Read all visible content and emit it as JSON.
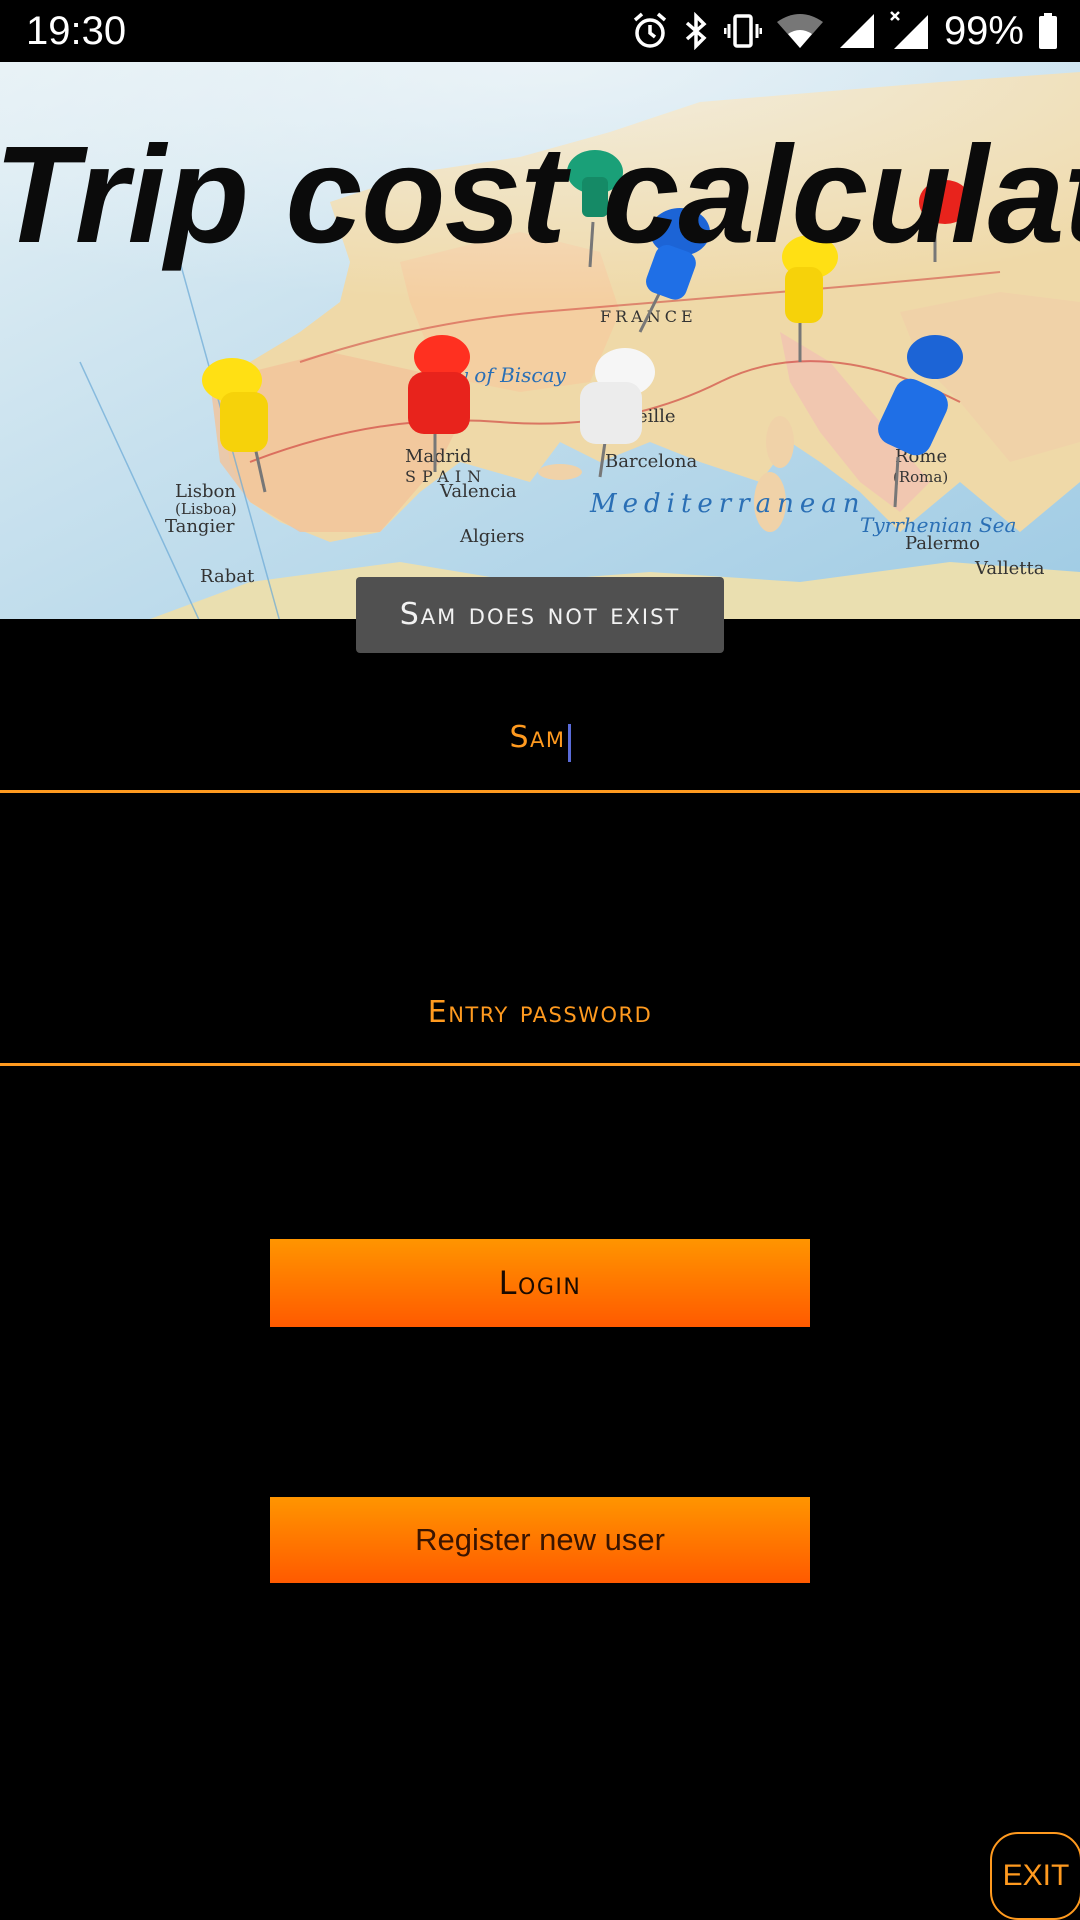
{
  "status_bar": {
    "time": "19:30",
    "battery": "99%",
    "icons": [
      "alarm-icon",
      "bluetooth-icon",
      "vibrate-icon",
      "wifi-icon",
      "signal-icon",
      "signal-no-data-icon",
      "battery-icon"
    ]
  },
  "header": {
    "title": "Trip cost calculator",
    "background": "europe-map-with-pushpins"
  },
  "toast": {
    "message": "Sam does not exist"
  },
  "form": {
    "username_value": "Sam",
    "password_placeholder": "Entry password",
    "login_label": "Login",
    "register_label": "Register new user",
    "exit_label": "EXIT"
  },
  "colors": {
    "accent": "#ff9a1f",
    "button_gradient_top": "#ff9500",
    "button_gradient_bottom": "#ff5a00",
    "background": "#000000",
    "toast_background": "#505050"
  }
}
